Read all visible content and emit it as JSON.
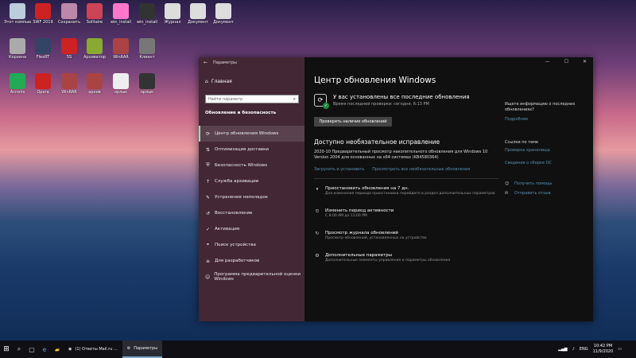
{
  "desktop_icons": [
    {
      "label": "Этот компьютер",
      "color": "#bcd"
    },
    {
      "label": "SWF 2019",
      "color": "#c22"
    },
    {
      "label": "Сохранить",
      "color": "#b8a"
    },
    {
      "label": "Solitaire",
      "color": "#c45"
    },
    {
      "label": "win_install",
      "color": "#f7c"
    },
    {
      "label": "win_install",
      "color": "#333"
    },
    {
      "label": "Журнал",
      "color": "#ddd"
    },
    {
      "label": "Документ",
      "color": "#ddd"
    },
    {
      "label": "Документ",
      "color": "#ddd"
    },
    {
      "label": "Корзина",
      "color": "#aaa"
    },
    {
      "label": "FlexRT",
      "color": "#346"
    },
    {
      "label": "5S",
      "color": "#c22"
    },
    {
      "label": "Архиватор",
      "color": "#8a3"
    },
    {
      "label": "WinRAR",
      "color": "#a44"
    },
    {
      "label": "Клиент",
      "color": "#777"
    },
    {
      "label": "Acronis",
      "color": "#2a5"
    },
    {
      "label": "Opera",
      "color": "#c22"
    },
    {
      "label": "WinRAR",
      "color": "#a44"
    },
    {
      "label": "архив",
      "color": "#a44"
    },
    {
      "label": "ярлык",
      "color": "#eee"
    },
    {
      "label": "ярлык",
      "color": "#333"
    }
  ],
  "window": {
    "title": "Параметры",
    "controls": {
      "minimize": "—",
      "maximize": "☐",
      "close": "✕"
    },
    "sidebar": {
      "home": "Главная",
      "search_placeholder": "Найти параметр",
      "section": "Обновление и безопасность",
      "items": [
        {
          "label": "Центр обновления Windows",
          "icon": "sync-icon"
        },
        {
          "label": "Оптимизация доставки",
          "icon": "delivery-icon"
        },
        {
          "label": "Безопасность Windows",
          "icon": "shield-icon"
        },
        {
          "label": "Служба архивации",
          "icon": "backup-icon"
        },
        {
          "label": "Устранение неполадок",
          "icon": "wrench-icon"
        },
        {
          "label": "Восстановление",
          "icon": "recovery-icon"
        },
        {
          "label": "Активация",
          "icon": "check-circle-icon"
        },
        {
          "label": "Поиск устройства",
          "icon": "location-icon"
        },
        {
          "label": "Для разработчиков",
          "icon": "dev-icon"
        },
        {
          "label": "Программа предварительной оценки Windows",
          "icon": "insider-icon"
        }
      ]
    },
    "main": {
      "title": "Центр обновления Windows",
      "status_title": "У вас установлены все последние обновления",
      "status_sub": "Время последней проверки: сегодня, 6:13 PM",
      "check_button": "Проверить наличие обновлений",
      "optional_title": "Доступно необязательное исправление",
      "update_desc": "2020-10 Предварительный просмотр накопительного обновления для Windows 10 Version 2004 для основанных на x64 системах (KB4580364)",
      "link_install": "Загрузить и установить",
      "link_view": "Просмотреть все необязательные обновления",
      "options": [
        {
          "title": "Приостановить обновления на 7 дн.",
          "desc": "Для изменения периода приостановки перейдите в раздел дополнительных параметров"
        },
        {
          "title": "Изменить период активности",
          "desc": "С 8:00 AM до 11:00 PM"
        },
        {
          "title": "Просмотр журнала обновлений",
          "desc": "Просмотр обновлений, установленных на устройстве"
        },
        {
          "title": "Дополнительные параметры",
          "desc": "Дополнительные элементы управления и параметры обновления"
        }
      ],
      "right": {
        "question": "Ищете информацию о последних обновлениях?",
        "more": "Подробнее",
        "related_title": "Ссылки по теме",
        "related_links": [
          "Проверка хранилища",
          "Сведения о сборке ОС"
        ],
        "help": "Получить помощь",
        "feedback": "Отправить отзыв"
      }
    }
  },
  "taskbar": {
    "tasks": [
      {
        "label": "(1) Ответы Mail.ru ...",
        "active": false
      },
      {
        "label": "Параметры",
        "active": true
      }
    ],
    "tray": {
      "lang": "ENG",
      "time": "10:42 PM",
      "date": "11/9/2020"
    }
  }
}
